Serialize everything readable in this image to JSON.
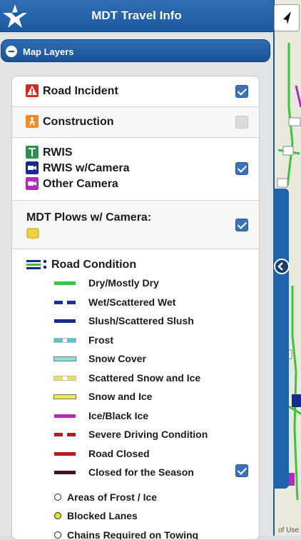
{
  "header": {
    "title": "MDT Travel Info",
    "logo_icon": "montana-star-icon"
  },
  "map": {
    "nav_icon": "location-arrow-icon",
    "terms_text": "of Use",
    "collapse_icon": "chevron-left-icon"
  },
  "panel": {
    "section_label": "Map Layers",
    "section_icon": "minus-circle-icon"
  },
  "layers": [
    {
      "label": "Road Incident",
      "icon": "road-incident-icon",
      "color": "#d42a1f",
      "checked": true
    },
    {
      "label": "Construction",
      "icon": "construction-icon",
      "color": "#f08a24",
      "checked": false
    },
    {
      "label": "RWIS",
      "icon": "rwis-icon",
      "color": "#2f8f4e"
    },
    {
      "label": "RWIS w/Camera",
      "icon": "rwis-camera-icon",
      "color": "#1a2a8c",
      "checked": true
    },
    {
      "label": "Other Camera",
      "icon": "other-camera-icon",
      "color": "#b12ab8"
    },
    {
      "label": "MDT Plows w/ Camera:",
      "icon": "plow-camera-icon",
      "color": "#f2d23a",
      "checked": true
    }
  ],
  "road_condition": {
    "title": "Road Condition",
    "icon": "road-condition-icon",
    "checked": true,
    "items": [
      {
        "label": "Dry/Mostly Dry",
        "color": "#3cc43c",
        "style": "solid"
      },
      {
        "label": "Wet/Scattered Wet",
        "color": "#1f2f9f",
        "style": "dashed"
      },
      {
        "label": "Slush/Scattered Slush",
        "color": "#1a2a8c",
        "style": "solid"
      },
      {
        "label": "Frost",
        "color": "#49c9c7",
        "style": "dashed-outline"
      },
      {
        "label": "Snow Cover",
        "color": "#8be0dd",
        "style": "solid-outline"
      },
      {
        "label": "Scattered Snow and Ice",
        "color": "#e6e05a",
        "style": "dashed-outline"
      },
      {
        "label": "Snow and Ice",
        "color": "#ecec3a",
        "style": "solid-outline"
      },
      {
        "label": "Ice/Black Ice",
        "color": "#b42ab8",
        "style": "solid"
      },
      {
        "label": "Severe Driving Condition",
        "color": "#b01e1e",
        "style": "dashed"
      },
      {
        "label": "Road Closed",
        "color": "#b01e1e",
        "style": "solid"
      },
      {
        "label": "Closed for the Season",
        "color": "#4a0f1a",
        "style": "solid"
      }
    ],
    "markers": [
      {
        "label": "Areas of Frost / Ice",
        "fill": "#ffffff"
      },
      {
        "label": "Blocked Lanes",
        "fill": "#e6e020"
      },
      {
        "label": "Chains Required on Towing",
        "fill": "#ffffff"
      }
    ]
  }
}
